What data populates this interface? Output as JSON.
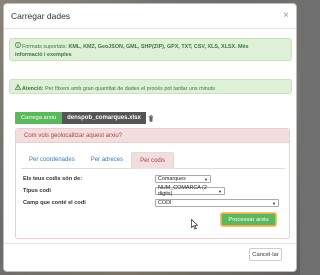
{
  "modal": {
    "title": "Carregar dades",
    "close_symbol": "×"
  },
  "alert_formats": {
    "icon": "info-icon",
    "prefix": "Formats suportats: ",
    "formats": "KML, KMZ, GeoJSON, GML, SHP(ZIP), GPX, TXT, CSV, XLS, XLSX. Més",
    "more": "informació i exemples"
  },
  "alert_warning": {
    "icon": "warning-icon",
    "label": "Atenció:",
    "text": " Per fitxers amb gran quantitat de dades el procés pot tardar uns minuts"
  },
  "upload": {
    "button_label": "Carrega arxiu",
    "file_name": "denspob_comarques.xlsx",
    "trash_icon": "trash-icon"
  },
  "geolocate_panel": {
    "heading": "Com vols geolocalitzar aquest arxiu?",
    "tabs": [
      {
        "label": "Per coordenades"
      },
      {
        "label": "Per adreces"
      },
      {
        "label": "Per codis"
      }
    ],
    "active_tab": "Per codis",
    "fields": {
      "codes_label": "Els teus codis són de:",
      "codes_value": "Comarques",
      "type_label": "Tipus codi",
      "type_value": "NUM_COMARCA (2 digits)",
      "column_label": "Camp que conté el codi",
      "column_value": "CODI"
    },
    "process_label": "Processar arxiu"
  },
  "footer": {
    "cancel_label": "Cancel·lar"
  },
  "colors": {
    "success": "#5cb85c",
    "alert_bg": "#dff0d8",
    "danger_bg": "#f2dede",
    "danger_text": "#a94442",
    "link": "#337ab7"
  }
}
